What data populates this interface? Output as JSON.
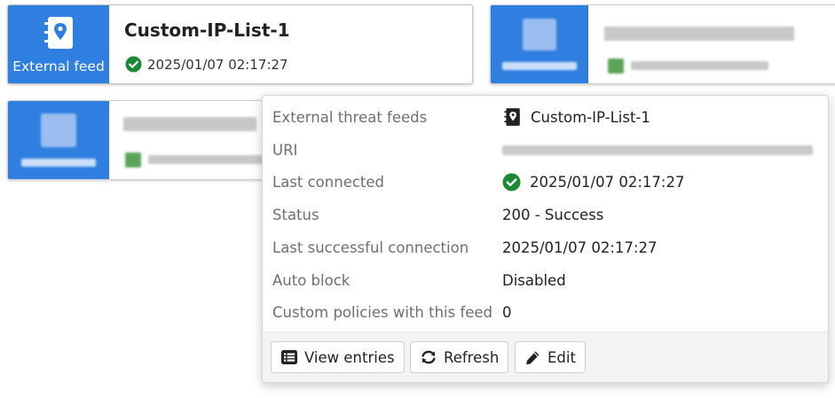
{
  "cards": [
    {
      "side_caption": "External feed",
      "title": "Custom-IP-List-1",
      "last_connected": "2025/01/07 02:17:27",
      "selected": true,
      "icon": "notebook-location-icon",
      "status_icon": "check-circle-icon"
    },
    {
      "obscured": true
    },
    {
      "obscured": true
    }
  ],
  "popover": {
    "rows": [
      {
        "label": "External threat feeds",
        "value": "Custom-IP-List-1",
        "icon": "notebook-location-icon"
      },
      {
        "label": "URI",
        "value": ""
      },
      {
        "label": "Last connected",
        "value": "2025/01/07 02:17:27",
        "icon": "check-circle-icon"
      },
      {
        "label": "Status",
        "value": "200 - Success"
      },
      {
        "label": "Last successful connection",
        "value": "2025/01/07 02:17:27"
      },
      {
        "label": "Auto block",
        "value": "Disabled"
      },
      {
        "label": "Custom policies with this feed",
        "value": "0"
      }
    ],
    "buttons": [
      {
        "label": "View entries",
        "icon": "list-icon"
      },
      {
        "label": "Refresh",
        "icon": "refresh-icon"
      },
      {
        "label": "Edit",
        "icon": "pencil-icon"
      }
    ]
  },
  "colors": {
    "accent_blue": "#2f7fe0",
    "success_green": "#1a8a34",
    "label_gray": "#6f6f6f"
  }
}
